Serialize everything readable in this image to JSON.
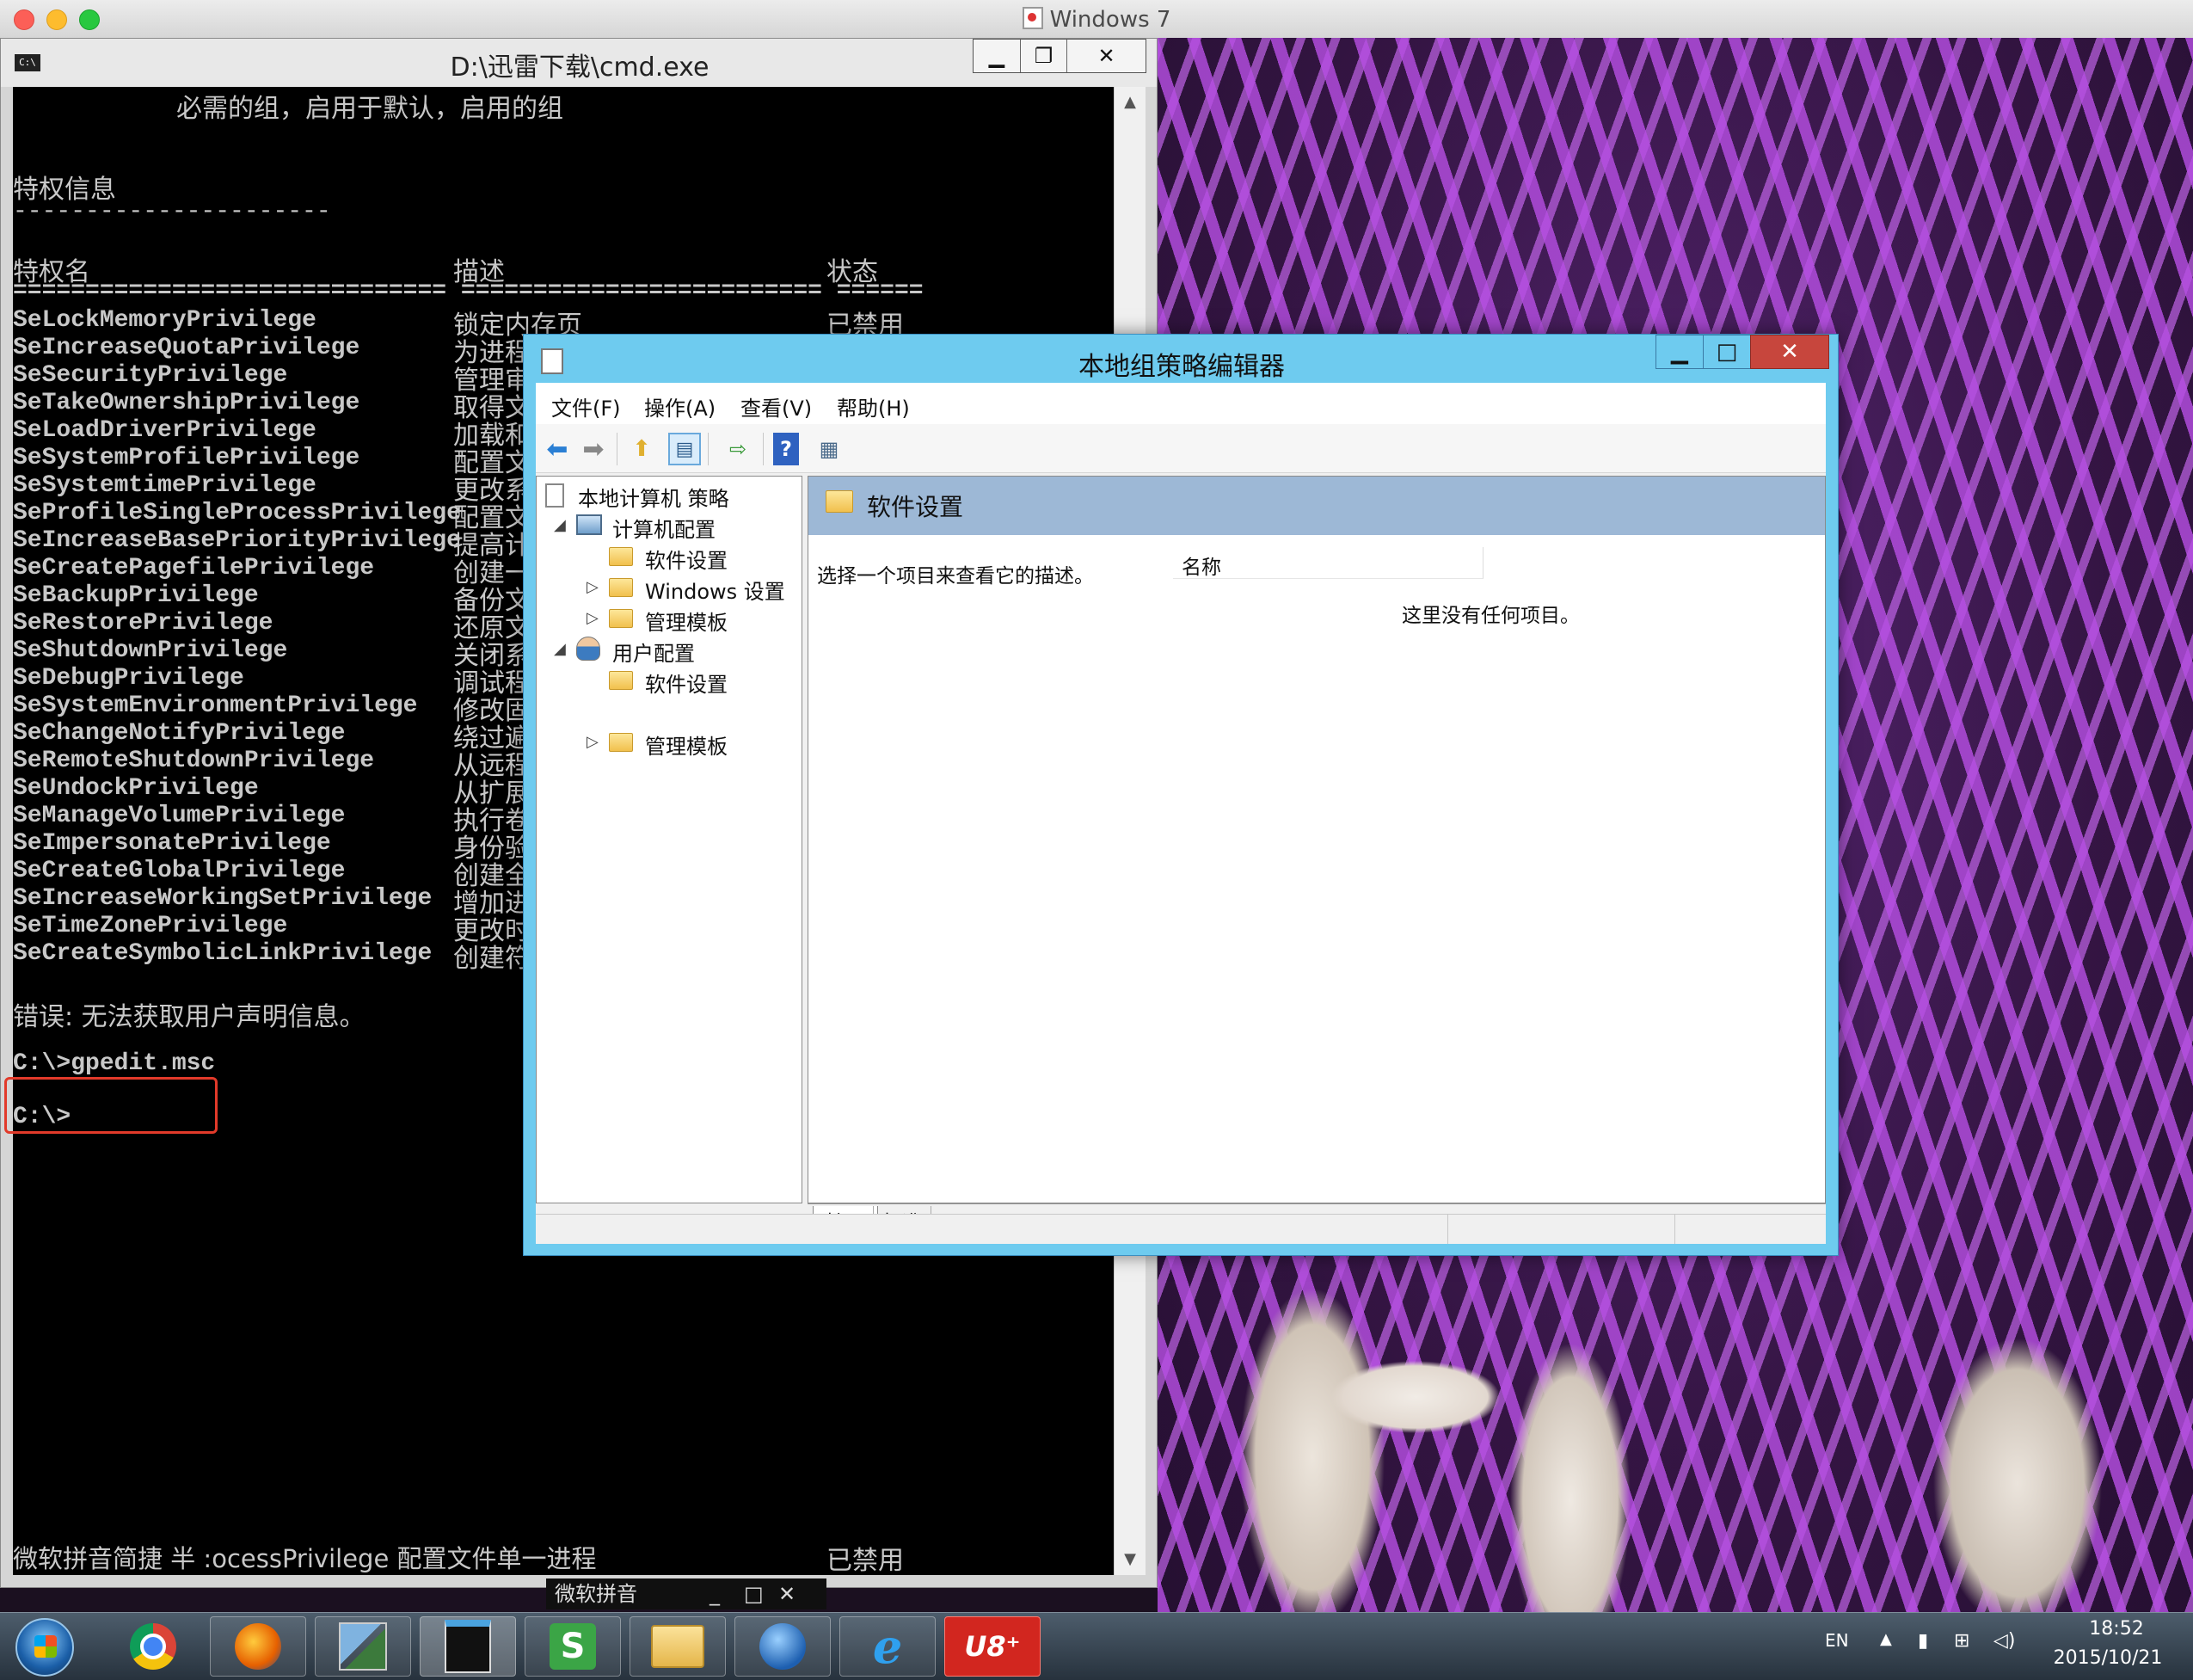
{
  "host": {
    "title": "Windows 7"
  },
  "cmd": {
    "title": "D:\\迅雷下载\\cmd.exe",
    "icon_text": "C:\\",
    "lines": [
      "必需的组，启用于默认，启用的组",
      "特权信息",
      "----------------------",
      "特权名",
      "描述",
      "状态",
      "============================== ========================= ======",
      "SeLockMemoryPrivilege",
      "SeIncreaseQuotaPrivilege",
      "SeSecurityPrivilege",
      "SeTakeOwnershipPrivilege",
      "SeLoadDriverPrivilege",
      "SeSystemProfilePrivilege",
      "SeSystemtimePrivilege",
      "SeProfileSingleProcessPrivilege",
      "SeIncreaseBasePriorityPrivilege",
      "SeCreatePagefilePrivilege",
      "SeBackupPrivilege",
      "SeRestorePrivilege",
      "SeShutdownPrivilege",
      "SeDebugPrivilege",
      "SeSystemEnvironmentPrivilege",
      "SeChangeNotifyPrivilege",
      "SeRemoteShutdownPrivilege",
      "SeUndockPrivilege",
      "SeManageVolumePrivilege",
      "SeImpersonatePrivilege",
      "SeCreateGlobalPrivilege",
      "SeIncreaseWorkingSetPrivilege",
      "SeTimeZonePrivilege",
      "SeCreateSymbolicLinkPrivilege",
      "错误: 无法获取用户声明信息。",
      "C:\\>gpedit.msc",
      "C:\\>"
    ],
    "desc_col": [
      "锁定内存页",
      "为进程",
      "管理审",
      "取得文",
      "加载和",
      "配置文",
      "更改系",
      "配置文",
      "提高计",
      "创建一",
      "备份文",
      "还原文",
      "关闭系",
      "调试程",
      "修改固",
      "绕过遍",
      "从远程",
      "从扩展",
      "执行卷",
      "身份验",
      "创建全",
      "增加进",
      "更改时",
      "创建符"
    ],
    "first_status": "已禁用",
    "bottom_line": "微软拼音简捷 半 :ocessPrivilege 配置文件单一进程",
    "bottom_status": "已禁用",
    "ime_text": "微软拼音"
  },
  "gpedit": {
    "title": "本地组策略编辑器",
    "menu": [
      "文件(F)",
      "操作(A)",
      "查看(V)",
      "帮助(H)"
    ],
    "tree": {
      "root": "本地计算机 策略",
      "computer": "计算机配置",
      "computer_children": [
        "软件设置",
        "Windows 设置",
        "管理模板"
      ],
      "user": "用户配置",
      "user_children": [
        "软件设置",
        "管理模板"
      ]
    },
    "pane_title": "软件设置",
    "description": "选择一个项目来查看它的描述。",
    "column_name": "名称",
    "empty_text": "这里没有任何项目。",
    "tabs": [
      "扩展",
      "标准"
    ]
  },
  "taskbar": {
    "lang": "EN",
    "time": "18:52",
    "date": "2015/10/21"
  }
}
